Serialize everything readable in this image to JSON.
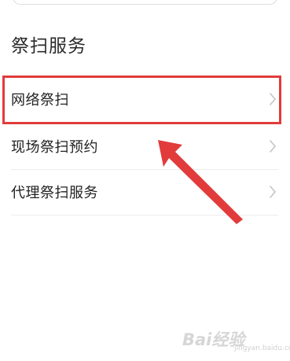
{
  "section": {
    "title": "祭扫服务"
  },
  "rows": [
    {
      "label": "网络祭扫"
    },
    {
      "label": "现场祭扫预约"
    },
    {
      "label": "代理祭扫服务"
    }
  ],
  "annotation": {
    "highlight_color": "#e23b3b"
  },
  "watermark": {
    "text": "Bai经验",
    "sub": "jingyan.baidu.com"
  }
}
